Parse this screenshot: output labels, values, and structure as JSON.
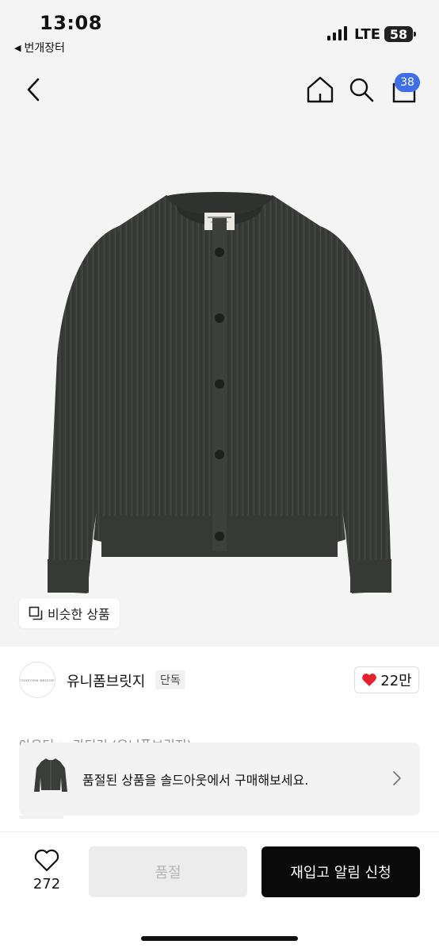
{
  "status_bar": {
    "time": "13:08",
    "back_app": "번개장터",
    "network": "LTE",
    "battery": "58"
  },
  "header": {
    "cart_count": "38"
  },
  "hero": {
    "similar_button": "비슷한 상품"
  },
  "store": {
    "logo_text": "UNIFORM BRIDGE",
    "name": "유니폼브릿지",
    "tag": "단독",
    "likes": "22만"
  },
  "breadcrumb": "아우터 > 카디건 (유니폼브릿지)",
  "banner": {
    "text": "품절된 상품을 솔드아웃에서 구매해보세요."
  },
  "bottom_bar": {
    "favorite_count": "272",
    "soldout_label": "품절",
    "restock_label": "재입고 알림 신청"
  },
  "colors": {
    "accent_badge": "#3f6fe8",
    "like_heart": "#e5202f",
    "cta_background": "#0a0a0a",
    "garment": "#3a3d3a"
  }
}
